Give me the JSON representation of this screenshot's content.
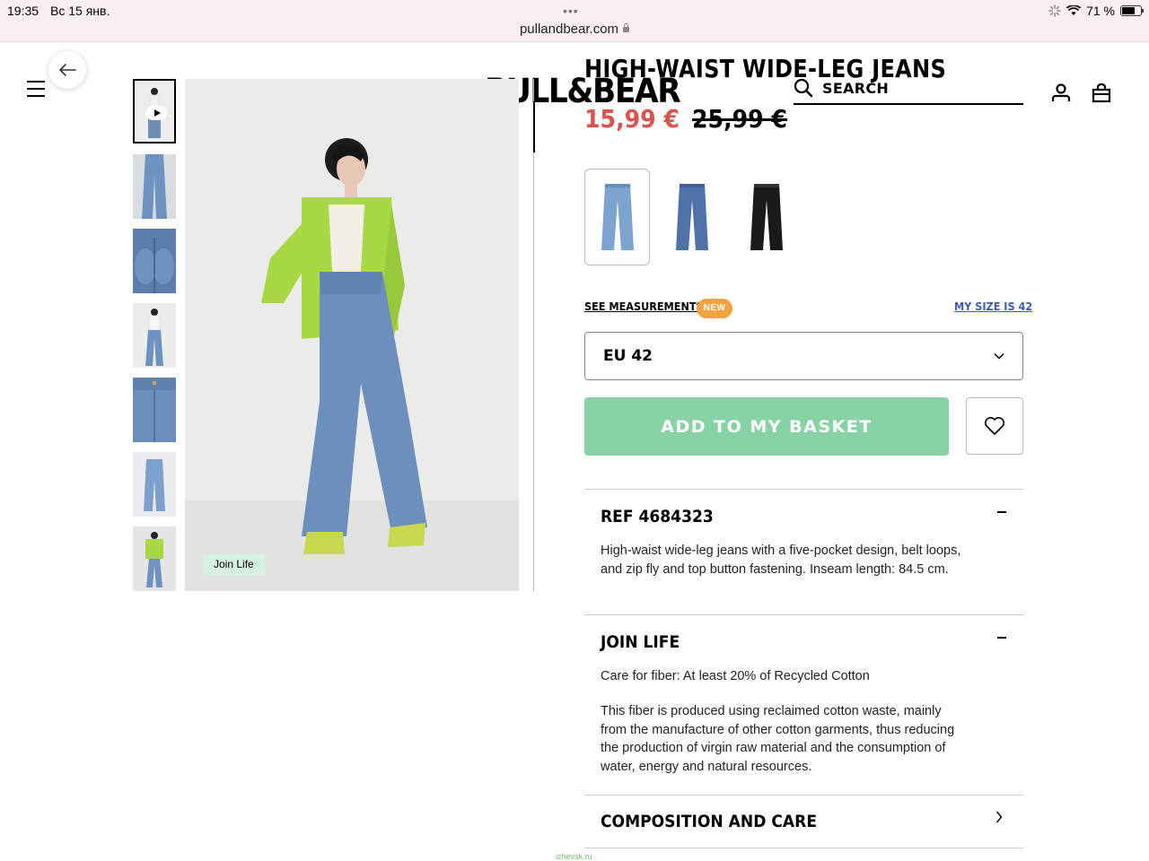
{
  "status_bar": {
    "time": "19:35",
    "date": "Вс 15 янв.",
    "url": "pullandbear.com",
    "battery": "71 %",
    "battery_level": 0.71
  },
  "header": {
    "logo": "PULL&BEAR",
    "search_label": "SEARCH",
    "icons": [
      "menu-icon",
      "back-arrow-icon",
      "search-icon",
      "user-icon",
      "bag-icon"
    ]
  },
  "gallery": {
    "thumbnail_count": 7,
    "badge": "Join Life"
  },
  "product": {
    "title": "HIGH-WAIST WIDE-LEG JEANS",
    "price": "15,99 €",
    "old_price": "25,99 €",
    "colors": [
      "light-blue",
      "mid-blue",
      "black"
    ],
    "measurements_link": "SEE MEASUREMENTS",
    "new_badge": "NEW",
    "my_size_link": "MY SIZE IS 42",
    "selected_size": "EU 42",
    "add_button": "ADD TO MY BASKET"
  },
  "sections": {
    "ref": {
      "title": "REF 4684323",
      "text": "High-waist wide-leg jeans with a five-pocket design, belt loops, and zip fly and top button fastening. Inseam length: 84.5 cm."
    },
    "join_life": {
      "title": "JOIN LIFE",
      "text1": "Care for fiber: At least 20% of Recycled Cotton",
      "text2": "This fiber is produced using reclaimed cotton waste, mainly from the manufacture of other cotton garments, thus reducing the production of virgin raw material and the consumption of water, energy and natural resources."
    },
    "composition": {
      "title": "COMPOSITION AND CARE"
    }
  },
  "watermark": "izhevsk.ru",
  "colors": {
    "price_red": "#d9534f",
    "add_button_green": "#88d3a6",
    "link_blue": "#3f5bb8",
    "new_badge_orange": "#f0a442",
    "join_life_green": "#d5f2e0"
  }
}
